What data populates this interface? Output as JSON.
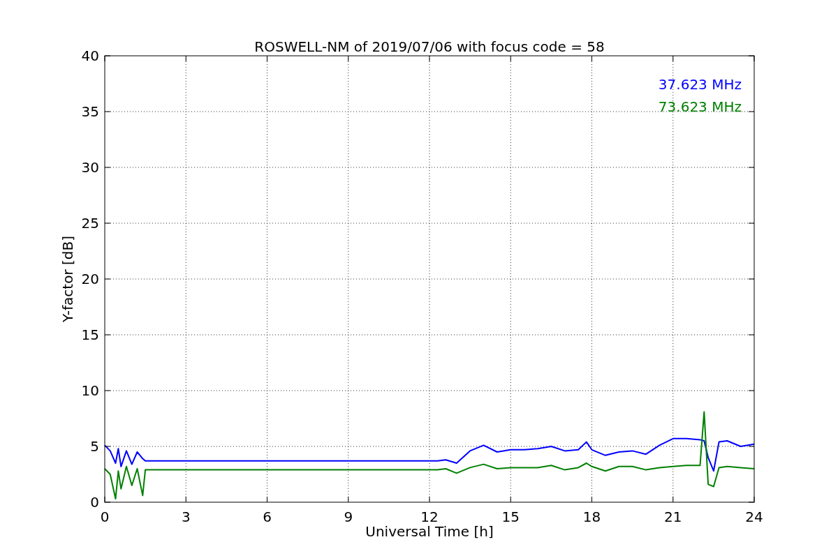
{
  "chart_data": {
    "type": "line",
    "title": "ROSWELL-NM of 2019/07/06 with focus code = 58",
    "xlabel": "Universal Time [h]",
    "ylabel": "Y-factor [dB]",
    "x": [
      0,
      0.2,
      0.4,
      0.5,
      0.6,
      0.8,
      1.0,
      1.2,
      1.4,
      1.5,
      12.3,
      12.6,
      13,
      13.5,
      14,
      14.5,
      15,
      15.5,
      16,
      16.5,
      17,
      17.5,
      17.8,
      18,
      18.5,
      19,
      19.5,
      20,
      20.5,
      21,
      21.5,
      22,
      22.15,
      22.3,
      22.5,
      22.7,
      23,
      23.5,
      24
    ],
    "series": [
      {
        "name": "37.623 MHz",
        "color": "#0000ff",
        "values": [
          5.1,
          4.6,
          3.5,
          4.8,
          3.2,
          4.6,
          3.4,
          4.5,
          3.9,
          3.7,
          3.7,
          3.8,
          3.5,
          4.6,
          5.1,
          4.5,
          4.7,
          4.7,
          4.8,
          5.0,
          4.6,
          4.7,
          5.4,
          4.7,
          4.2,
          4.5,
          4.6,
          4.3,
          5.1,
          5.7,
          5.7,
          5.6,
          5.5,
          4.0,
          2.8,
          5.4,
          5.5,
          5.0,
          5.2
        ]
      },
      {
        "name": "73.623 MHz",
        "color": "#008000",
        "values": [
          3.0,
          2.5,
          0.3,
          2.8,
          1.2,
          3.2,
          1.5,
          3.0,
          0.6,
          2.9,
          2.9,
          3.0,
          2.6,
          3.1,
          3.4,
          3.0,
          3.1,
          3.1,
          3.1,
          3.3,
          2.9,
          3.1,
          3.5,
          3.2,
          2.8,
          3.2,
          3.2,
          2.9,
          3.1,
          3.2,
          3.3,
          3.3,
          8.1,
          1.6,
          1.4,
          3.1,
          3.2,
          3.1,
          3.0
        ]
      }
    ],
    "xlim": [
      0,
      24
    ],
    "ylim": [
      0,
      40
    ],
    "xticks": [
      0,
      3,
      6,
      9,
      12,
      15,
      18,
      21,
      24
    ],
    "yticks": [
      0,
      5,
      10,
      15,
      20,
      25,
      30,
      35,
      40
    ],
    "grid": true
  }
}
